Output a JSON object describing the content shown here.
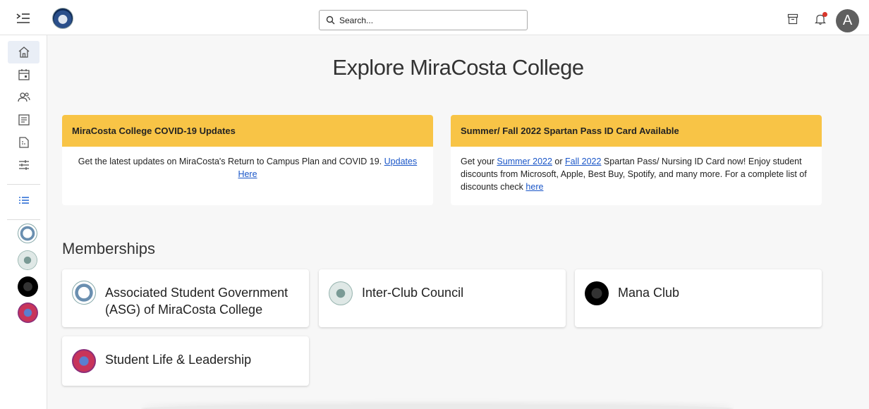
{
  "header": {
    "search_placeholder": "Search...",
    "avatar_letter": "A"
  },
  "page": {
    "title": "Explore MiraCosta College"
  },
  "announcements": [
    {
      "title": "MiraCosta College COVID-19 Updates",
      "body": "Get the latest updates on MiraCosta's Return to Campus Plan and COVID 19. ",
      "link": "Updates Here "
    },
    {
      "title": "Summer/ Fall 2022 Spartan Pass ID Card Available",
      "body_1": "Get your ",
      "link_1": "Summer 2022",
      "body_2": " or ",
      "link_2": "Fall 2022",
      "body_3": " Spartan Pass/ Nursing ID Card now! Enjoy student discounts from Microsoft, Apple, Best Buy, Spotify, and many more. For a complete list of discounts check ",
      "link_3": "here"
    }
  ],
  "memberships": {
    "title": "Memberships",
    "items": [
      {
        "name": "Associated Student Government (ASG) of MiraCosta College"
      },
      {
        "name": "Inter-Club Council"
      },
      {
        "name": "Mana Club"
      },
      {
        "name": "Student Life & Leadership"
      }
    ]
  },
  "colors": {
    "accent": "#f8c446",
    "link": "#1a56c8",
    "notification_dot": "#d9362b"
  }
}
